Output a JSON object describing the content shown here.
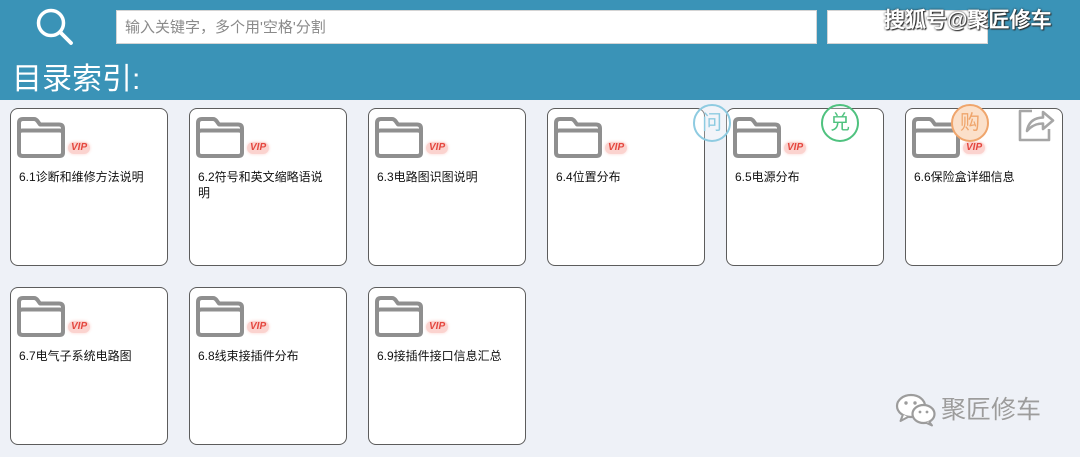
{
  "header": {
    "search_placeholder": "输入关键字，多个用'空格'分割",
    "watermark": "搜狐号@聚匠修车"
  },
  "page_title": "目录索引:",
  "folders": [
    {
      "label": "6.1诊断和维修方法说明",
      "badge": "VIP"
    },
    {
      "label": "6.2符号和英文缩略语说明",
      "badge": "VIP"
    },
    {
      "label": "6.3电路图识图说明",
      "badge": "VIP"
    },
    {
      "label": "6.4位置分布",
      "badge": "VIP"
    },
    {
      "label": "6.5电源分布",
      "badge": "VIP"
    },
    {
      "label": "6.6保险盒详细信息",
      "badge": "VIP"
    },
    {
      "label": "6.7电气子系统电路图",
      "badge": "VIP"
    },
    {
      "label": "6.8线束接插件分布",
      "badge": "VIP"
    },
    {
      "label": "6.9接插件接口信息汇总",
      "badge": "VIP"
    }
  ],
  "icons": {
    "search": "search-icon",
    "folder": "folder-icon",
    "share": "share-icon",
    "wechat": "wechat-icon"
  },
  "floating_actions": [
    {
      "label": "问",
      "icon": "ask-icon",
      "color": "#8ecbe1"
    },
    {
      "label": "兑",
      "icon": "redeem-icon",
      "color": "#4fc27f"
    },
    {
      "label": "购",
      "icon": "buy-icon",
      "color": "#efa56c",
      "fill": "#fbe0ca"
    },
    {
      "icon": "share-icon",
      "color": "#a6a6a6"
    }
  ],
  "footer_watermark": {
    "icon": "wechat-icon",
    "text": "聚匠修车"
  },
  "colors": {
    "header_bg": "#3a93b7",
    "page_bg": "#eef1f7",
    "card_bg": "#ffffff",
    "card_border": "#5c5c5c",
    "folder_stroke": "#8f8f8f",
    "vip_text": "#e4473f",
    "vip_glow": "#fbd3cf",
    "watermark_gray": "#9c9c9c"
  }
}
